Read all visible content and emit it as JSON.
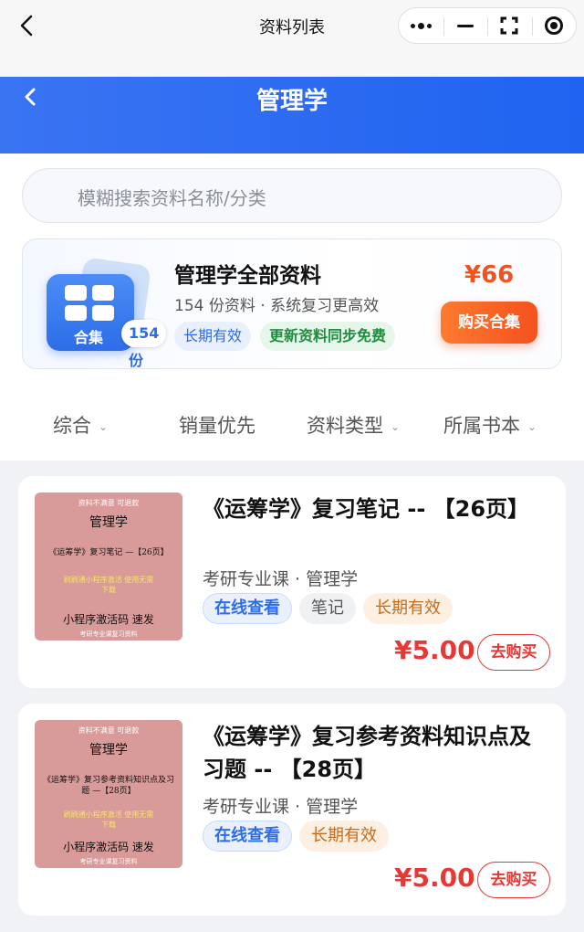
{
  "topbar": {
    "title": "资料列表",
    "back_icon": "chevron-left-icon"
  },
  "header": {
    "title": "管理学",
    "back_icon": "chevron-left-icon"
  },
  "search": {
    "placeholder": "模糊搜索资料名称/分类"
  },
  "bundle": {
    "icon_label": "合集",
    "badge": "154份",
    "title": "管理学全部资料",
    "subtitle": "154 份资料 · 系统复习更高效",
    "tags": [
      "长期有效",
      "更新资料同步免费"
    ],
    "price": "¥66",
    "buy_label": "购买合集"
  },
  "filters": [
    {
      "label": "综合",
      "has_dropdown": true
    },
    {
      "label": "销量优先",
      "has_dropdown": false
    },
    {
      "label": "资料类型",
      "has_dropdown": true
    },
    {
      "label": "所属书本",
      "has_dropdown": true
    }
  ],
  "items": [
    {
      "thumb": {
        "header": "资料不满意  可退款",
        "subject": "管理学",
        "doc_title": "《运筹学》复习笔记 —【26页】",
        "note": "刷刷通小程序激活 使用无需下载",
        "activation": "小程序激活码 速发",
        "footer": "考研专业课复习资料"
      },
      "title": "《运筹学》复习笔记 -- 【26页】",
      "meta": "考研专业课 · 管理学",
      "tags": [
        "在线查看",
        "笔记",
        "长期有效"
      ],
      "price": "¥5.00",
      "buy_label": "去购买"
    },
    {
      "thumb": {
        "header": "资料不满意  可退款",
        "subject": "管理学",
        "doc_title": "《运筹学》复习参考资料知识点及习题 —【28页】",
        "note": "刷刷通小程序激活 使用无需下载",
        "activation": "小程序激活码 速发",
        "footer": "考研专业课复习资料"
      },
      "title": "《运筹学》复习参考资料知识点及习题 -- 【28页】",
      "meta": "考研专业课 · 管理学",
      "tags": [
        "在线查看",
        "长期有效"
      ],
      "price": "¥5.00",
      "buy_label": "去购买"
    }
  ]
}
